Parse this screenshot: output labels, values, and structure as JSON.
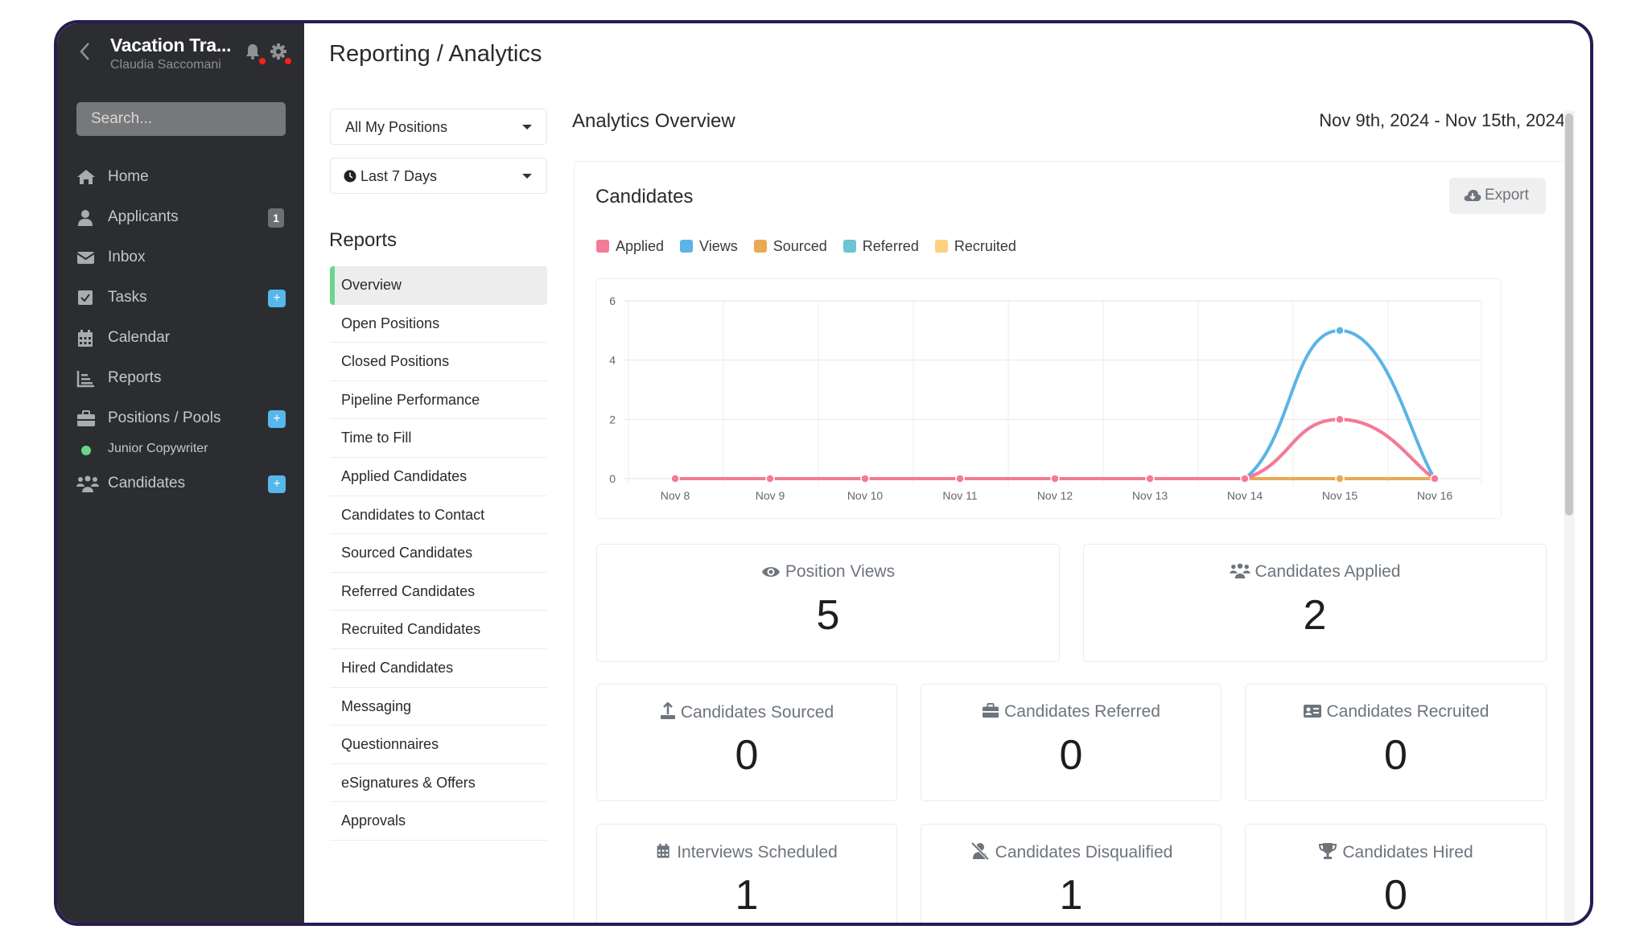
{
  "sidebar": {
    "org_title": "Vacation Tra...",
    "user_name": "Claudia Saccomani",
    "search_placeholder": "Search...",
    "items": [
      {
        "label": "Home",
        "icon": "home-icon"
      },
      {
        "label": "Applicants",
        "icon": "user-icon",
        "badge": "1"
      },
      {
        "label": "Inbox",
        "icon": "envelope-icon"
      },
      {
        "label": "Tasks",
        "icon": "checkbox-icon",
        "plus": "+"
      },
      {
        "label": "Calendar",
        "icon": "calendar-icon"
      },
      {
        "label": "Reports",
        "icon": "chart-icon"
      },
      {
        "label": "Positions / Pools",
        "icon": "briefcase-icon",
        "plus": "+"
      },
      {
        "label": "Candidates",
        "icon": "users-icon",
        "plus": "+"
      }
    ],
    "sub_position": {
      "label": "Junior Copywriter",
      "status_color": "#6cd58a"
    }
  },
  "page": {
    "title": "Reporting / Analytics",
    "filters": {
      "positions": "All My Positions",
      "period": "Last 7 Days"
    },
    "reports_heading": "Reports",
    "reports": [
      {
        "label": "Overview",
        "active": true
      },
      {
        "label": "Open Positions"
      },
      {
        "label": "Closed Positions"
      },
      {
        "label": "Pipeline Performance"
      },
      {
        "label": "Time to Fill"
      },
      {
        "label": "Applied Candidates"
      },
      {
        "label": "Candidates to Contact"
      },
      {
        "label": "Sourced Candidates"
      },
      {
        "label": "Referred Candidates"
      },
      {
        "label": "Recruited Candidates"
      },
      {
        "label": "Hired Candidates"
      },
      {
        "label": "Messaging"
      },
      {
        "label": "Questionnaires"
      },
      {
        "label": "eSignatures & Offers"
      },
      {
        "label": "Approvals"
      }
    ]
  },
  "overview": {
    "title": "Analytics Overview",
    "date_range": "Nov 9th, 2024 - Nov 15th, 2024",
    "card_title": "Candidates",
    "export_label": "Export"
  },
  "chart_data": {
    "type": "line",
    "title": "Candidates",
    "xlabel": "",
    "ylabel": "",
    "x": [
      "Nov 8",
      "Nov 9",
      "Nov 10",
      "Nov 11",
      "Nov 12",
      "Nov 13",
      "Nov 14",
      "Nov 15",
      "Nov 16"
    ],
    "ylim": [
      0,
      6
    ],
    "yticks": [
      0,
      2,
      4,
      6
    ],
    "grid": true,
    "legend_position": "top-left",
    "series": [
      {
        "name": "Applied",
        "color": "#f47a96",
        "values": [
          0,
          0,
          0,
          0,
          0,
          0,
          0,
          2,
          0
        ]
      },
      {
        "name": "Views",
        "color": "#5ab4e6",
        "values": [
          0,
          0,
          0,
          0,
          0,
          0,
          0,
          5,
          0
        ]
      },
      {
        "name": "Sourced",
        "color": "#e9a955",
        "values": [
          0,
          0,
          0,
          0,
          0,
          0,
          0,
          0,
          0
        ]
      },
      {
        "name": "Referred",
        "color": "#6cc4d4",
        "values": [
          0,
          0,
          0,
          0,
          0,
          0,
          0,
          0,
          0
        ]
      },
      {
        "name": "Recruited",
        "color": "#fbd17f",
        "values": [
          0,
          0,
          0,
          0,
          0,
          0,
          0,
          0,
          0
        ]
      }
    ]
  },
  "stats": [
    {
      "label": "Position Views",
      "value": "5",
      "icon": "eye-icon"
    },
    {
      "label": "Candidates Applied",
      "value": "2",
      "icon": "users-icon"
    },
    {
      "label": "Candidates Sourced",
      "value": "0",
      "icon": "upload-icon"
    },
    {
      "label": "Candidates Referred",
      "value": "0",
      "icon": "briefcase-icon"
    },
    {
      "label": "Candidates Recruited",
      "value": "0",
      "icon": "id-card-icon"
    },
    {
      "label": "Interviews Scheduled",
      "value": "1",
      "icon": "calendar-icon"
    },
    {
      "label": "Candidates Disqualified",
      "value": "1",
      "icon": "user-slash-icon"
    },
    {
      "label": "Candidates Hired",
      "value": "0",
      "icon": "trophy-icon"
    }
  ]
}
